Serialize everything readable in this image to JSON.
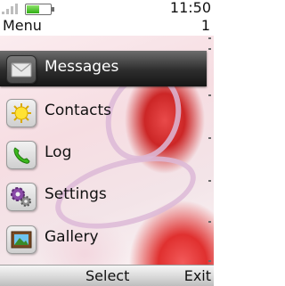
{
  "status": {
    "time": "11:50",
    "title": "Menu",
    "count": "1",
    "battery_level": 0.55
  },
  "menu": {
    "items": [
      {
        "label": "Messages",
        "icon": "envelope-icon",
        "selected": true
      },
      {
        "label": "Contacts",
        "icon": "sun-contacts-icon",
        "selected": false
      },
      {
        "label": "Log",
        "icon": "phone-icon",
        "selected": false
      },
      {
        "label": "Settings",
        "icon": "gears-icon",
        "selected": false
      },
      {
        "label": "Gallery",
        "icon": "picture-icon",
        "selected": false
      }
    ]
  },
  "softkeys": {
    "select": "Select",
    "exit": "Exit"
  },
  "colors": {
    "selected_bar": "#2d2d2d",
    "rose_red": "#e0302f",
    "ribbon": "#dcb9d7"
  }
}
